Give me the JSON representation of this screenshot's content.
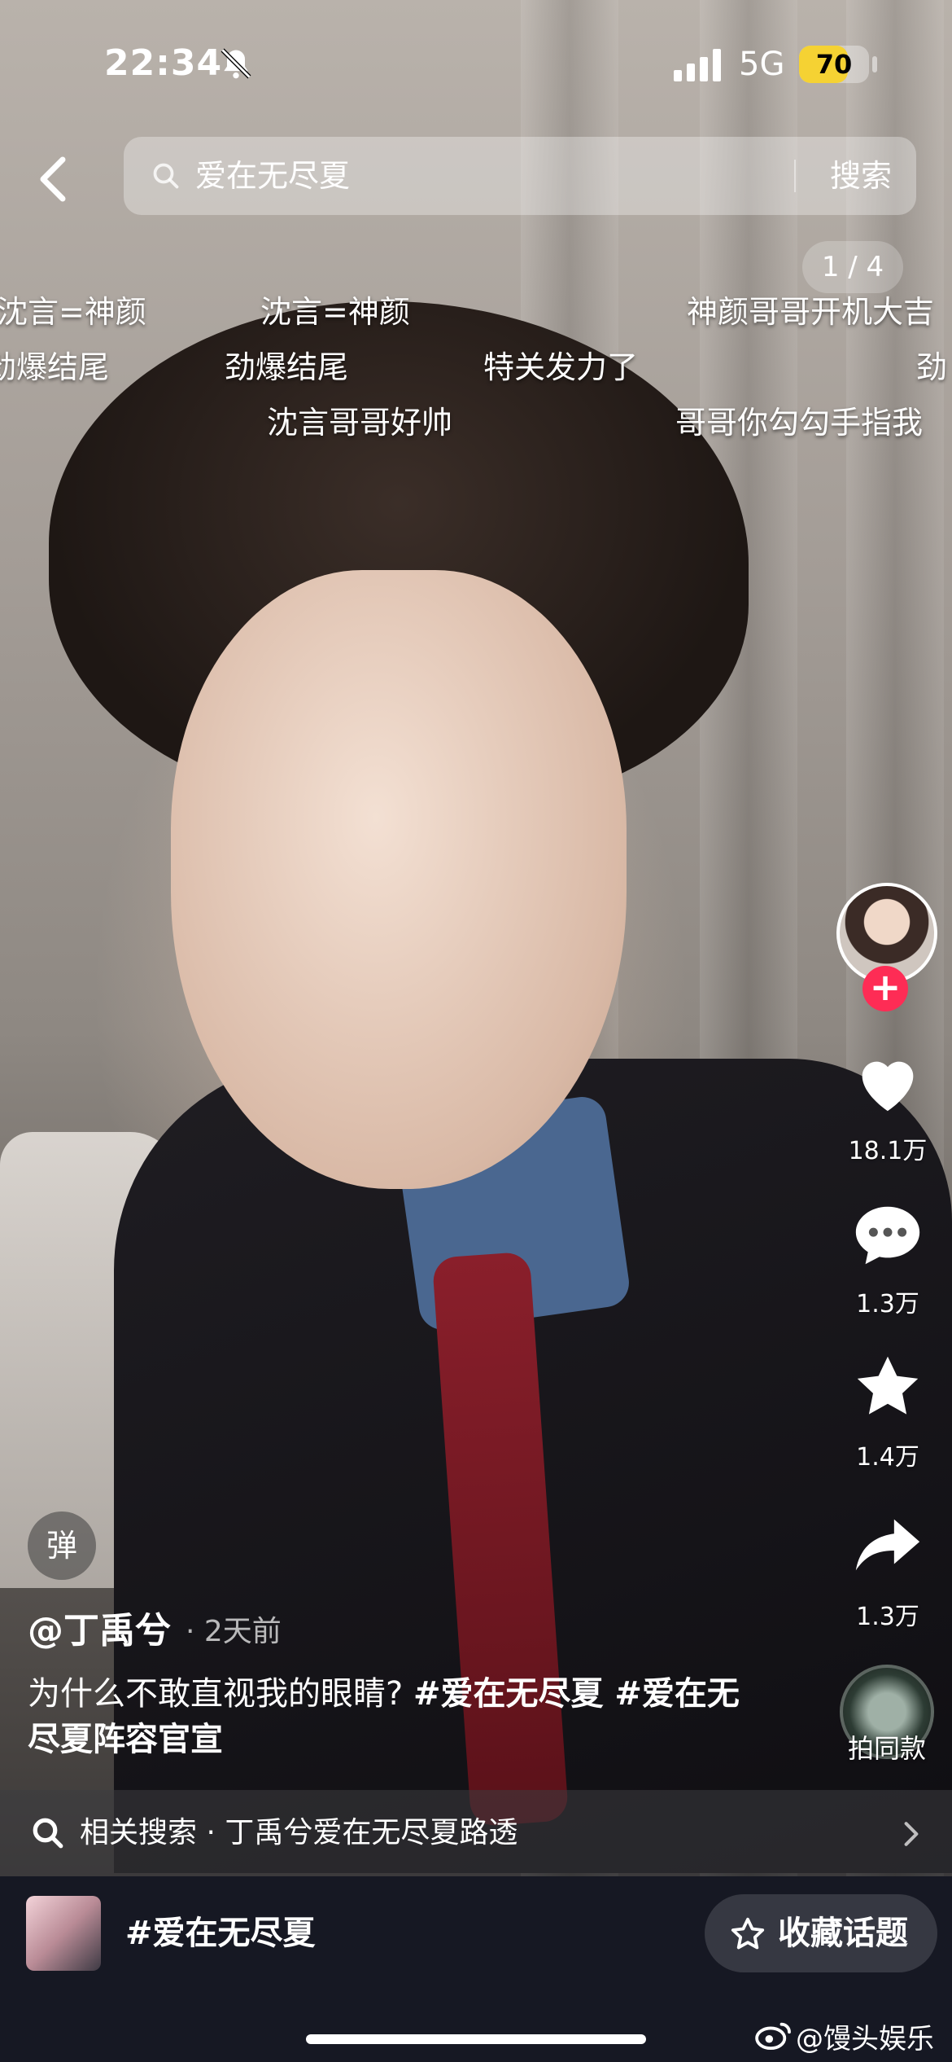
{
  "status_bar": {
    "time": "22:34",
    "network": "5G",
    "battery": "70",
    "battery_level": 0.7
  },
  "search": {
    "query": "爱在无尽夏",
    "button_label": "搜索"
  },
  "page_counter": "1 / 4",
  "danmaku": [
    "沈言=神颜",
    "沈言=神颜",
    "神颜哥哥开机大吉",
    "劲爆结尾",
    "劲爆结尾",
    "特关发力了",
    "劲",
    "沈言哥哥好帅",
    "哥哥你勾勾手指我"
  ],
  "rail": {
    "follow_symbol": "+",
    "likes": "18.1万",
    "comments": "1.3万",
    "favorites": "1.4万",
    "shares": "1.3万",
    "same_style_label": "拍同款"
  },
  "post": {
    "danmaku_toggle": "弹",
    "author": "@丁禹兮",
    "time": "· 2天前",
    "caption_text": "为什么不敢直视我的眼睛? ",
    "hashtag_1": "#爱在无尽夏",
    "hashtag_2": " #爱在无尽夏阵容官宣"
  },
  "related_search": {
    "label": "相关搜索 · 丁禹兮爱在无尽夏路透"
  },
  "topic": {
    "name": "#爱在无尽夏",
    "collect_label": "收藏话题"
  },
  "watermark": "@馒头娱乐酱",
  "colors": {
    "accent_red": "#fe2c55",
    "battery_yellow": "#f5d233",
    "bottom_bar": "#161823"
  },
  "icons": [
    "bell-muted-icon",
    "signal-icon",
    "back-icon",
    "search-icon",
    "heart-icon",
    "comment-icon",
    "star-icon",
    "share-icon",
    "chevron-right-icon",
    "star-outline-icon",
    "weibo-icon"
  ]
}
